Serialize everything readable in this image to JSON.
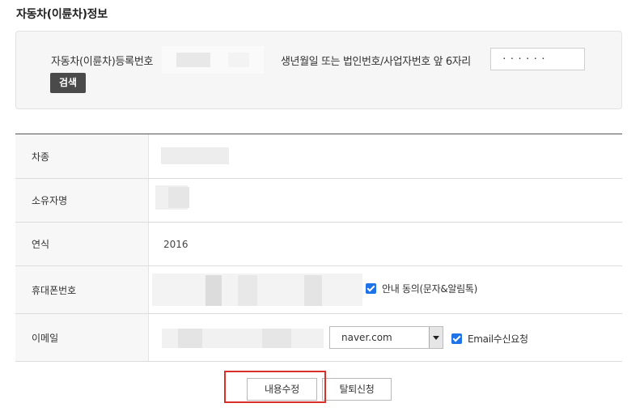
{
  "section": {
    "title": "자동차(이륜차)정보"
  },
  "search": {
    "reg_label": "자동차(이륜차)등록번호",
    "birth_label": "생년월일 또는 법인번호/사업자번호 앞 6자리",
    "birth_value": "······",
    "search_button": "검색"
  },
  "table": {
    "rows": [
      {
        "label": "차종",
        "value": ""
      },
      {
        "label": "소유자명",
        "value": ""
      },
      {
        "label": "연식",
        "value": "2016"
      },
      {
        "label": "휴대폰번호",
        "value": "",
        "consent_label": "안내 동의(문자&알림톡)",
        "consent_checked": true
      },
      {
        "label": "이메일",
        "value": "",
        "domain_selected": "naver.com",
        "email_consent_label": "Email수신요청",
        "email_consent_checked": true
      }
    ]
  },
  "actions": {
    "edit_button": "내용수정",
    "withdraw_button": "탈퇴신청"
  },
  "colors": {
    "checkbox": "#1e73e8",
    "highlight": "#d9302c",
    "search_button_bg": "#4a4a4a"
  }
}
